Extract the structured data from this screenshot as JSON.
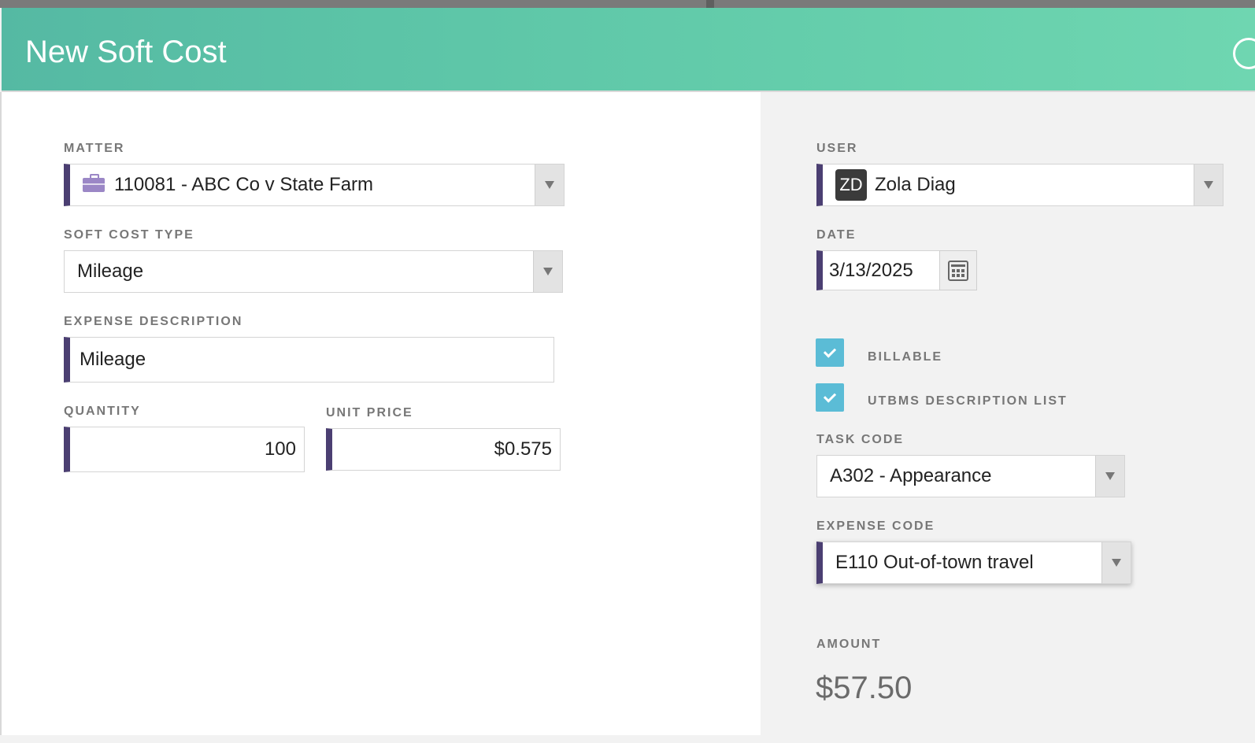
{
  "modal": {
    "title": "New Soft Cost"
  },
  "left": {
    "matter": {
      "label": "MATTER",
      "value": "110081 - ABC Co v State Farm",
      "icon": "briefcase-icon"
    },
    "soft_cost_type": {
      "label": "SOFT COST TYPE",
      "value": "Mileage"
    },
    "expense_description": {
      "label": "EXPENSE DESCRIPTION",
      "value": "Mileage"
    },
    "quantity": {
      "label": "QUANTITY",
      "value": "100"
    },
    "unit_price": {
      "label": "UNIT PRICE",
      "value": "$0.575"
    }
  },
  "right": {
    "user": {
      "label": "USER",
      "initials": "ZD",
      "value": "Zola Diag"
    },
    "date": {
      "label": "DATE",
      "value": "3/13/2025"
    },
    "billable": {
      "label": "BILLABLE",
      "checked": true
    },
    "utbms": {
      "label": "UTBMS DESCRIPTION LIST",
      "checked": true
    },
    "task_code": {
      "label": "TASK CODE",
      "value": "A302 - Appearance"
    },
    "expense_code": {
      "label": "EXPENSE CODE",
      "value": "E110 Out-of-town travel"
    },
    "amount": {
      "label": "AMOUNT",
      "value": "$57.50"
    }
  },
  "colors": {
    "header": "#5cc4a7",
    "required_marker": "#4b3f72",
    "checkbox": "#5bbcd6",
    "matter_icon": "#9b87c6"
  }
}
